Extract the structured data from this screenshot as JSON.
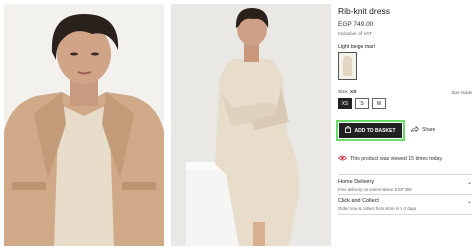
{
  "product": {
    "title": "Rib-knit dress",
    "price": "EGP 749.00",
    "vat_note": "Inclusive of VAT",
    "color_name": "Light beige marl"
  },
  "size": {
    "label": "Size:",
    "selected": "XS",
    "guide_label": "Size Guide",
    "options": [
      "XS",
      "S",
      "M"
    ]
  },
  "actions": {
    "add_to_basket": "ADD TO BASKET",
    "share": "Share"
  },
  "notice": {
    "viewed_text": "This product was viewed 15 times today."
  },
  "accordion": [
    {
      "title": "Home Delivery",
      "subtitle": "Free delivery on orders above EGP 399"
    },
    {
      "title": "Click and Collect",
      "subtitle": "Order now & collect from store in 1-3 days"
    }
  ],
  "colors": {
    "accent_green": "#6bdc6b",
    "viewed_icon": "#c8202e",
    "swatch": "#e3d6c2"
  }
}
